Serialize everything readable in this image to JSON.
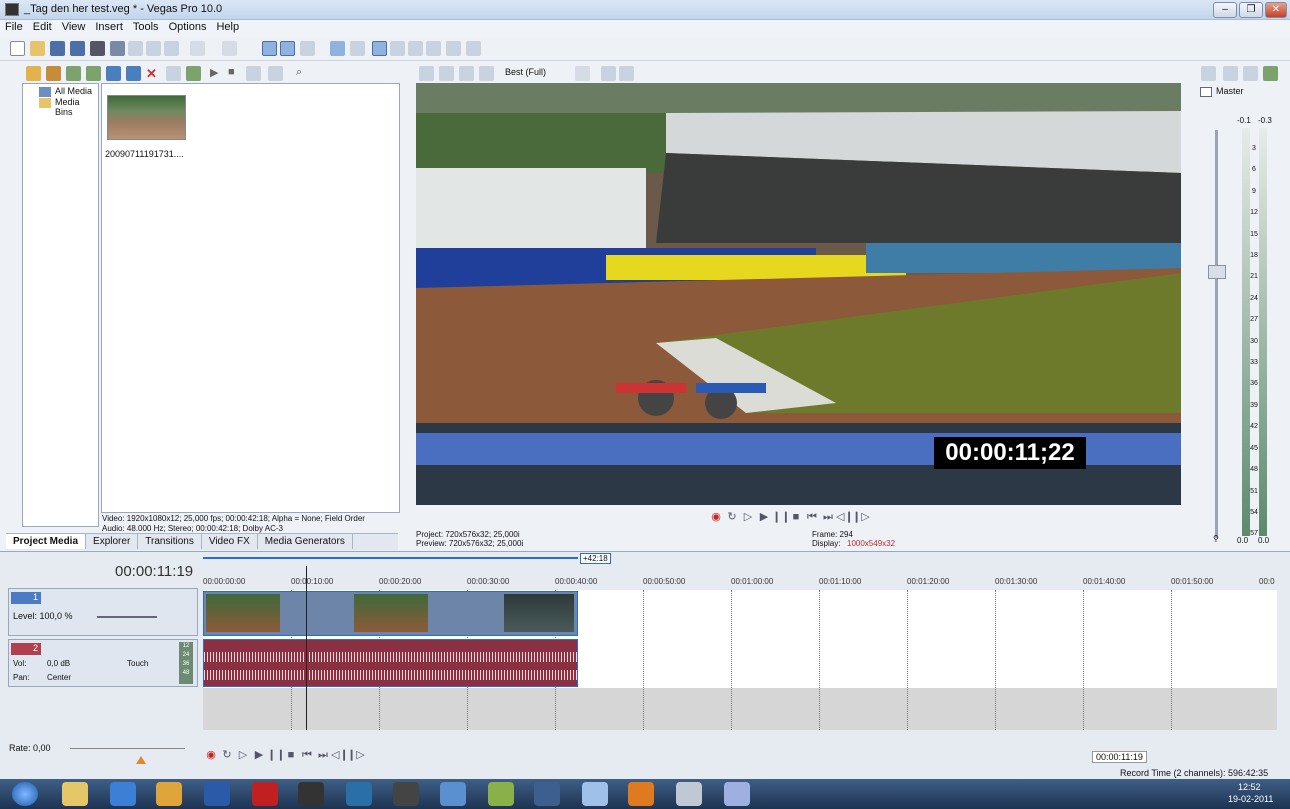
{
  "window": {
    "title": "_Tag den her test.veg * - Vegas Pro 10.0",
    "controls": [
      "–",
      "❐",
      "✕"
    ]
  },
  "menu": [
    "File",
    "Edit",
    "View",
    "Insert",
    "Tools",
    "Options",
    "Help"
  ],
  "media": {
    "tree": [
      "All Media",
      "Media Bins"
    ],
    "clip_name": "20090711191731....",
    "info_video": "Video: 1920x1080x12; 25,000 fps; 00:00:42:18; Alpha = None; Field Order",
    "info_audio": "Audio: 48.000 Hz; Stereo; 00:00:42:18; Dolby AC-3"
  },
  "tabs": [
    "Project Media",
    "Explorer",
    "Transitions",
    "Video FX",
    "Media Generators"
  ],
  "preview": {
    "quality": "Best (Full)",
    "timecode_overlay": "00:00:11;22",
    "project": "Project: 720x576x32; 25,000i",
    "preview": "Preview: 720x576x32; 25,000i",
    "frame": "Frame:  294",
    "display_label": "Display:",
    "display_value": "1000x549x32",
    "transport": [
      "◉",
      "↻",
      "▷",
      "▶",
      "❙❙",
      "■",
      "⏮",
      "⏭",
      "◁❙",
      "❙▷"
    ]
  },
  "mixer": {
    "title": "Master",
    "left": "-0.1",
    "right": "-0.3",
    "ticks": [
      "3",
      "6",
      "9",
      "12",
      "15",
      "18",
      "21",
      "24",
      "27",
      "30",
      "33",
      "36",
      "39",
      "42",
      "45",
      "48",
      "51",
      "54",
      "57"
    ],
    "out_left": "0.0",
    "out_right": "0.0"
  },
  "timeline": {
    "timecode": "00:00:11:19",
    "loop_end": "+42:18",
    "ruler": [
      "00:00:00:00",
      "00:00:10:00",
      "00:00:20:00",
      "00:00:30:00",
      "00:00:40:00",
      "00:00:50:00",
      "00:01:00:00",
      "00:01:10:00",
      "00:01:20:00",
      "00:01:30:00",
      "00:01:40:00",
      "00:01:50:00",
      "00:0"
    ],
    "video_track": {
      "num": "1",
      "level": "Level: 100,0 %"
    },
    "audio_track": {
      "num": "2",
      "vol_label": "Vol:",
      "vol": "0,0 dB",
      "pan_label": "Pan:",
      "pan": "Center",
      "mode": "Touch",
      "meter": [
        "12",
        "24",
        "36",
        "48"
      ]
    },
    "rate": "Rate: 0,00",
    "cursor": "00:00:11:19",
    "record_time": "Record Time (2 channels): 596:42:35"
  },
  "clock": {
    "time": "12:52",
    "date": "19-02-2011"
  },
  "colors": {
    "accent": "#1f5fbf",
    "audio_clip": "#8a3040",
    "track_selected": "#4a7bc4",
    "display": "#b03030"
  }
}
